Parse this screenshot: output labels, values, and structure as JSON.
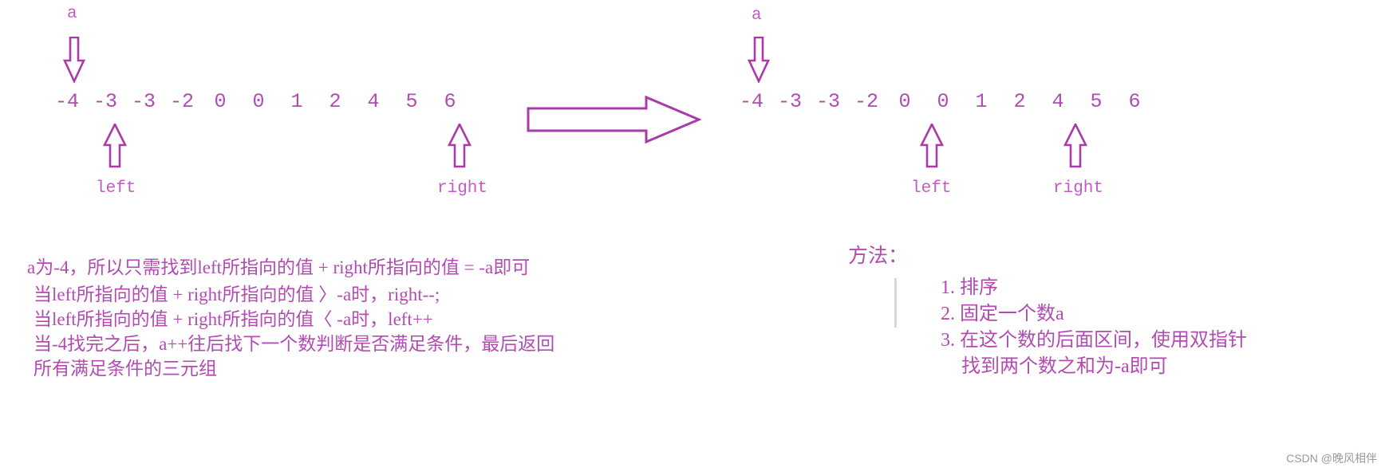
{
  "colors": {
    "ink": "#b24bb2",
    "ink_light": "#c25cc2",
    "rule": "#d8d8d8",
    "watermark": "#9a9a9a",
    "background": "#ffffff"
  },
  "diagrams": [
    {
      "id": "before",
      "array": [
        "-4",
        "-3",
        "-3",
        "-2",
        "0",
        "0",
        "1",
        "2",
        "4",
        "5",
        "6"
      ],
      "pointers": {
        "a": {
          "label": "a",
          "direction": "down",
          "index": 0
        },
        "left": {
          "label": "left",
          "direction": "up",
          "index": 1
        },
        "right": {
          "label": "right",
          "direction": "up",
          "index": 10
        }
      }
    },
    {
      "id": "after",
      "array": [
        "-4",
        "-3",
        "-3",
        "-2",
        "0",
        "0",
        "1",
        "2",
        "4",
        "5",
        "6"
      ],
      "pointers": {
        "a": {
          "label": "a",
          "direction": "down",
          "index": 0
        },
        "left": {
          "label": "left",
          "direction": "up",
          "index": 4
        },
        "right": {
          "label": "right",
          "direction": "up",
          "index": 8
        }
      }
    }
  ],
  "transition_arrow": {
    "name": "big-right-arrow"
  },
  "left_text": {
    "lines": [
      "a为-4，所以只需找到left所指向的值 + right所指向的值 = -a即可",
      "当left所指向的值 + right所指向的值 〉-a时，right--;",
      "当left所指向的值 + right所指向的值〈 -a时，left++",
      "当-4找完之后，a++往后找下一个数判断是否满足条件，最后返回",
      "所有满足条件的三元组"
    ]
  },
  "right_text": {
    "heading": "方法：",
    "items": [
      {
        "num": "1.",
        "text": "排序",
        "cont": ""
      },
      {
        "num": "2.",
        "text": "固定一个数a",
        "cont": ""
      },
      {
        "num": "3.",
        "text": "在这个数的后面区间，使用双指针",
        "cont": "找到两个数之和为-a即可"
      }
    ]
  },
  "watermark": "CSDN @晚风相伴"
}
